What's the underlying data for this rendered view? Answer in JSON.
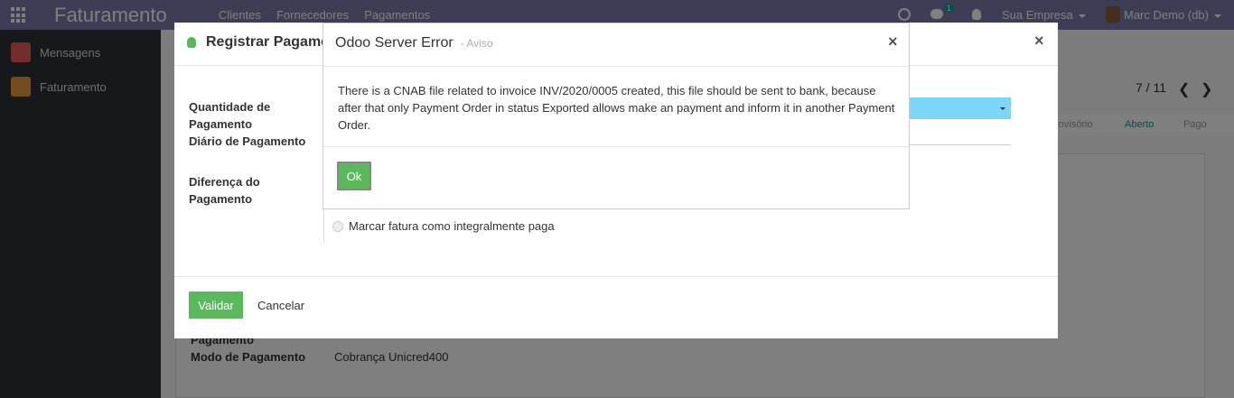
{
  "navbar": {
    "brand": "Faturamento",
    "menu": [
      "Clientes",
      "Fornecedores",
      "Pagamentos"
    ],
    "chat_badge": "1",
    "company": "Sua Empresa",
    "user": "Marc Demo (db)"
  },
  "sidebar": {
    "items": [
      {
        "label": "Mensagens",
        "icon": "messages-icon"
      },
      {
        "label": "Faturamento",
        "icon": "invoicing-icon"
      }
    ]
  },
  "background": {
    "pager": "7 / 11",
    "statuses": [
      "rovisório",
      "Aberto",
      "Pago"
    ],
    "active_status": "Aberto",
    "labels": [
      "Pagamento",
      "Modo de Pagamento"
    ],
    "payment_mode_value": "Cobrança Unicred400"
  },
  "payment_modal": {
    "title": "Registrar Pagamento",
    "label_amount": "Quantidade de Pagamento",
    "label_journal": "Diário de Pagamento",
    "label_difference": "Diferença do Pagamento",
    "radio_label": "Marcar fatura como integralmente paga",
    "validate_label": "Validar",
    "cancel_label": "Cancelar",
    "close_symbol": "×"
  },
  "error_modal": {
    "title": "Odoo Server Error",
    "subtitle": "- Aviso",
    "message": "There is a CNAB file related to invoice INV/2020/0005 created, this file should be sent to bank, because after that only Payment Order in status Exported allows make an payment and inform it in another Payment Order.",
    "ok_label": "Ok",
    "close_symbol": "×"
  },
  "colors": {
    "navbar": "#7c7bad",
    "accent": "#00a09d",
    "success": "#5cb85c",
    "select_highlight": "#7cd6f7"
  }
}
